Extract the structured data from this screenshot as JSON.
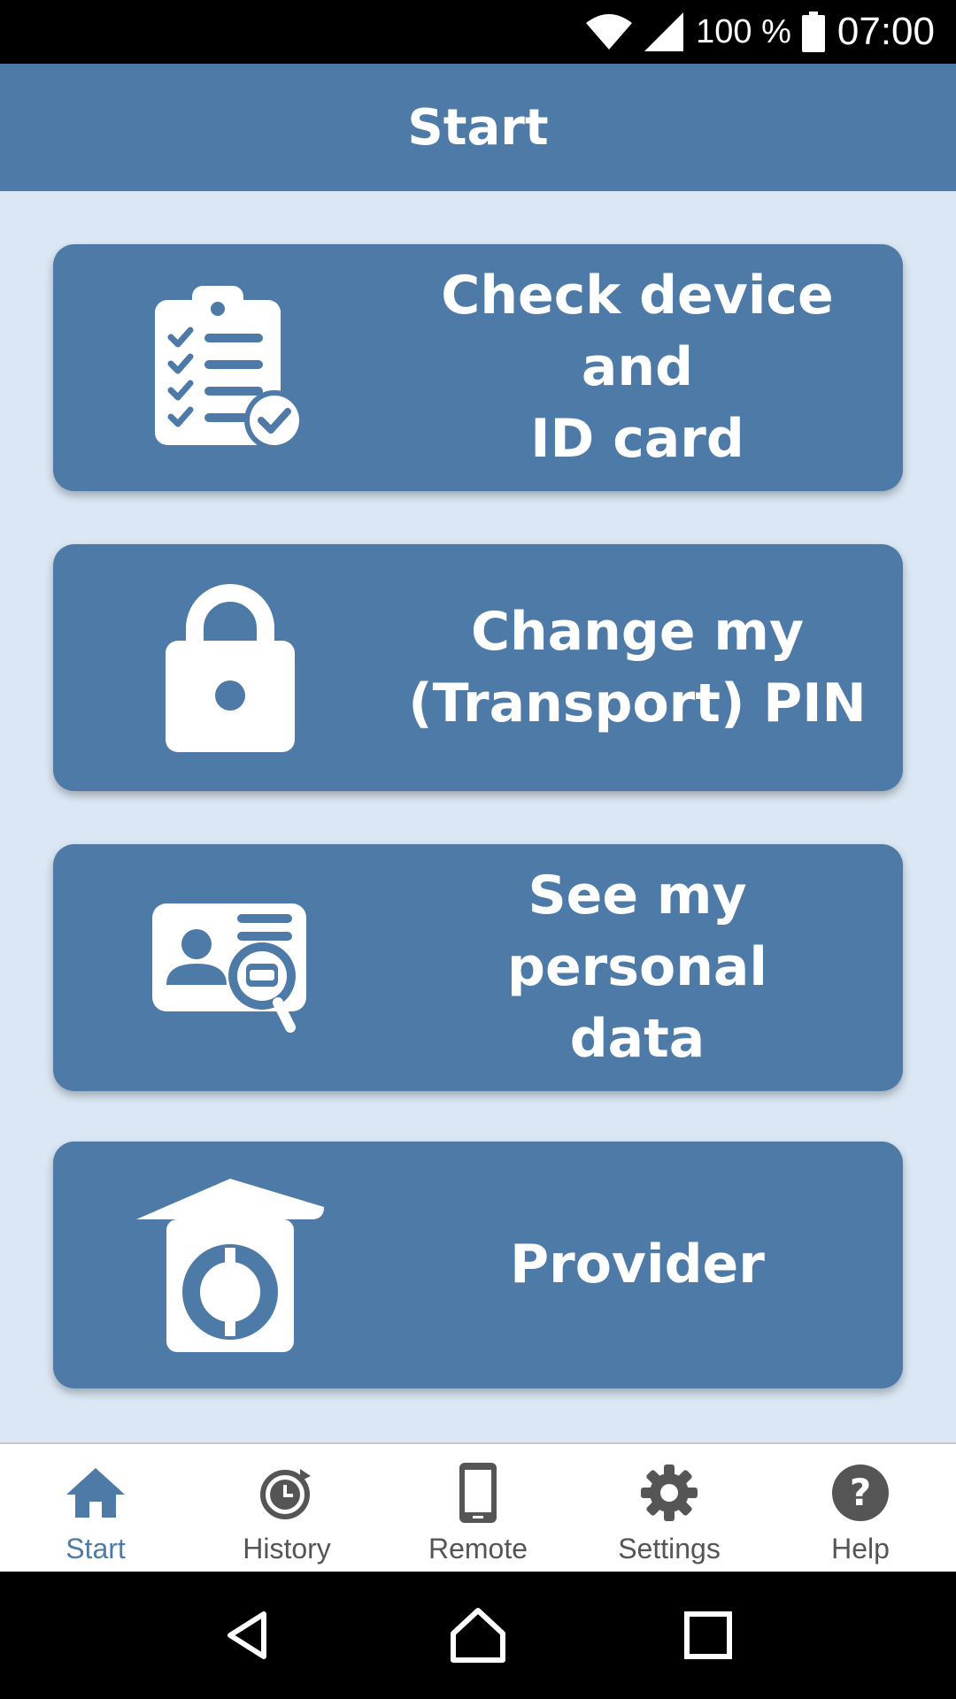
{
  "status_bar": {
    "battery": "100 %",
    "time": "07:00",
    "icons": [
      "wifi-icon",
      "signal-icon",
      "battery-icon"
    ]
  },
  "header": {
    "title": "Start"
  },
  "tiles": [
    {
      "label": "Check device and\nID card",
      "icon": "clipboard-check-icon"
    },
    {
      "label": "Change my\n(Transport) PIN",
      "icon": "lock-icon"
    },
    {
      "label": "See my personal\ndata",
      "icon": "id-card-search-icon"
    },
    {
      "label": "Provider",
      "icon": "provider-house-icon"
    }
  ],
  "bottom_nav": {
    "active": "Start",
    "items": [
      {
        "label": "Start",
        "icon": "home-icon"
      },
      {
        "label": "History",
        "icon": "history-icon"
      },
      {
        "label": "Remote",
        "icon": "phone-icon"
      },
      {
        "label": "Settings",
        "icon": "gear-icon"
      },
      {
        "label": "Help",
        "icon": "help-icon"
      }
    ]
  },
  "system_nav": {
    "icons": [
      "back-icon",
      "home-icon",
      "recents-icon"
    ]
  },
  "colors": {
    "primary": "#4e7aa7",
    "background": "#dbe7f4",
    "nav_inactive": "#555555"
  }
}
